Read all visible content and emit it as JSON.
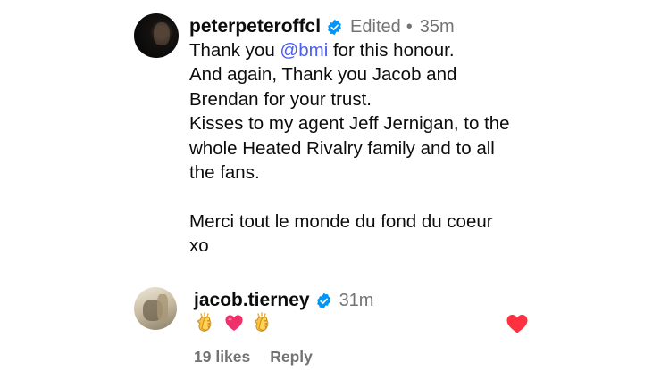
{
  "comments": [
    {
      "username": "peterpeteroffcl",
      "edited_label": "Edited",
      "time": "35m",
      "text_lines": [
        {
          "prefix": "Thank you ",
          "mention": "@bmi",
          "suffix": " for this honour."
        },
        {
          "text": "And again, Thank you Jacob and"
        },
        {
          "text": "Brendan for your trust."
        },
        {
          "text": "Kisses to my agent Jeff Jernigan, to the"
        },
        {
          "text": "whole Heated Rivalry family and to all"
        },
        {
          "text": "the fans."
        },
        {
          "text": ""
        },
        {
          "text": "Merci tout le monde du fond du coeur"
        },
        {
          "text": "xo"
        }
      ]
    },
    {
      "username": "jacob.tierney",
      "time": "31m",
      "emojis": [
        "clapping-hands",
        "pink-heart",
        "clapping-hands"
      ],
      "likes_label": "19 likes",
      "reply_label": "Reply",
      "liked": true
    }
  ],
  "colors": {
    "verified": "#0095f6",
    "mention": "#4a5df5",
    "heart": "#ff3040",
    "muted": "#737373"
  },
  "icons": {
    "verified": "verified-badge-icon",
    "like": "heart-icon"
  }
}
